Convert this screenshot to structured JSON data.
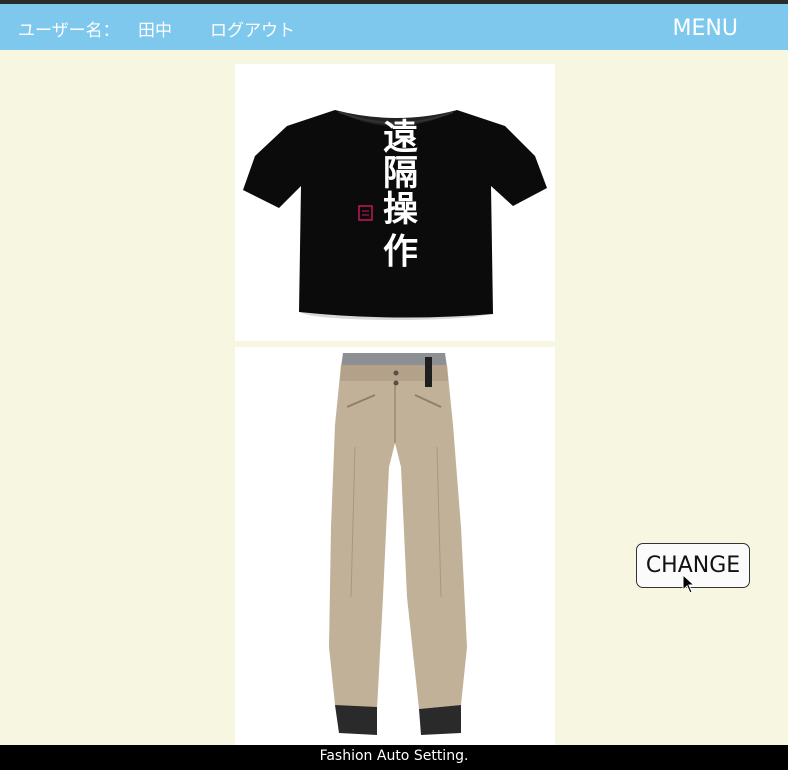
{
  "header": {
    "user_label": "ユーザー名：",
    "user_name": "田中",
    "logout_label": "ログアウト",
    "menu_label": "MENU",
    "background_color": "#7dc8ec"
  },
  "outfit": {
    "top": {
      "type": "black t-shirt",
      "print_text": "遠隔操作",
      "shirt_color": "#0b0b0b"
    },
    "bottom": {
      "type": "beige pants",
      "pants_color": "#c2b199"
    }
  },
  "change_button": {
    "label": "CHANGE"
  },
  "footer": {
    "text": "Fashion Auto Setting."
  }
}
